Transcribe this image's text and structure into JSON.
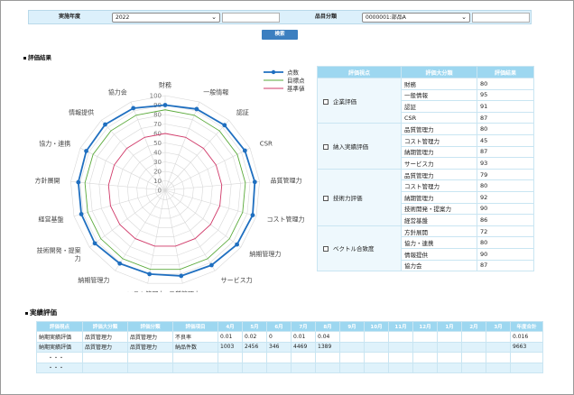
{
  "filters": {
    "year_label": "実施年度",
    "year_value": "2022",
    "category_label": "品目分類",
    "category_value": "0000001:部品A",
    "search_label": "検索"
  },
  "colors": {
    "score": "#1f6fc0",
    "target": "#5aaa3a",
    "standard": "#d23a6a",
    "header": "#9dd7f0"
  },
  "evaluation": {
    "section_title": "評価結果",
    "headers": [
      "評価視点",
      "評価大分類",
      "評価結果"
    ],
    "groups": [
      {
        "name": "企業評価",
        "items": [
          {
            "label": "財務",
            "score": "80"
          },
          {
            "label": "一般情報",
            "score": "95"
          },
          {
            "label": "認証",
            "score": "91"
          },
          {
            "label": "CSR",
            "score": "87"
          }
        ]
      },
      {
        "name": "納入実績評価",
        "items": [
          {
            "label": "品質管理力",
            "score": "80"
          },
          {
            "label": "コスト管理力",
            "score": "45"
          },
          {
            "label": "納期管理力",
            "score": "87"
          },
          {
            "label": "サービス力",
            "score": "93"
          }
        ]
      },
      {
        "name": "技術力評価",
        "items": [
          {
            "label": "品質管理力",
            "score": "79"
          },
          {
            "label": "コスト管理力",
            "score": "80"
          },
          {
            "label": "納期管理力",
            "score": "92"
          },
          {
            "label": "技術開発・提案力",
            "score": "90"
          },
          {
            "label": "経営基盤",
            "score": "86"
          }
        ]
      },
      {
        "name": "ベクトル合致度",
        "items": [
          {
            "label": "方針展開",
            "score": "72"
          },
          {
            "label": "協力・連携",
            "score": "80"
          },
          {
            "label": "情報提供",
            "score": "90"
          },
          {
            "label": "協力会",
            "score": "87"
          }
        ]
      }
    ]
  },
  "chart_data": {
    "type": "radar",
    "axes": [
      "財務",
      "一般情報",
      "認証",
      "CSR",
      "品質管理力",
      "コスト管理力",
      "納期管理力",
      "サービス力",
      "品質管理力",
      "コスト管理力",
      "納期管理力",
      "技術開発・提案力",
      "経営基盤",
      "方針展開",
      "協力・連携",
      "情報提供",
      "協力会"
    ],
    "axis_label_lines": [
      [
        "財務"
      ],
      [
        "一般情報"
      ],
      [
        "認証"
      ],
      [
        "CSR"
      ],
      [
        "品質管理力"
      ],
      [
        "コスト管理力"
      ],
      [
        "納期管理力"
      ],
      [
        "サービス力"
      ],
      [
        "品質管理力"
      ],
      [
        "コスト管理力"
      ],
      [
        "納期管理力"
      ],
      [
        "技術開発・提案",
        "力"
      ],
      [
        "経営基盤"
      ],
      [
        "方針展開"
      ],
      [
        "協力・連携"
      ],
      [
        "情報提供"
      ],
      [
        "協力会"
      ]
    ],
    "rmin": 0,
    "rmax": 100,
    "ticks": [
      "0",
      "10",
      "20",
      "30",
      "40",
      "50",
      "60",
      "70",
      "80",
      "90",
      "100"
    ],
    "grid": true,
    "legend_position": "top-right",
    "series": [
      {
        "name": "点数",
        "color": "#1f6fc0",
        "markers": true,
        "values": [
          90,
          92,
          93,
          94,
          95,
          96,
          95,
          93,
          92,
          90,
          91,
          93,
          92,
          92,
          93,
          94,
          93
        ]
      },
      {
        "name": "目標点",
        "color": "#5aaa3a",
        "markers": false,
        "values": [
          85,
          85,
          85,
          85,
          85,
          85,
          85,
          85,
          85,
          85,
          85,
          85,
          85,
          85,
          85,
          85,
          85
        ]
      },
      {
        "name": "基準値",
        "color": "#d23a6a",
        "markers": false,
        "values": [
          60,
          60,
          60,
          60,
          60,
          60,
          60,
          60,
          60,
          60,
          60,
          60,
          60,
          60,
          60,
          60,
          60
        ]
      }
    ]
  },
  "actual": {
    "section_title": "実績評価",
    "headers": [
      "評価視点",
      "評価大分類",
      "評価分類",
      "評価項目",
      "4月",
      "5月",
      "6月",
      "7月",
      "8月",
      "9月",
      "10月",
      "11月",
      "12月",
      "1月",
      "2月",
      "3月",
      "年度合計"
    ],
    "rows": [
      [
        "納期実績評価",
        "品質管理力",
        "品質管理力",
        "不良率",
        "0.01",
        "0.02",
        "0",
        "0.01",
        "0.04",
        "",
        "",
        "",
        "",
        "",
        "",
        "",
        "0.016"
      ],
      [
        "納期実績評価",
        "品質管理力",
        "品質管理力",
        "納品件数",
        "1003",
        "2456",
        "346",
        "4469",
        "1389",
        "",
        "",
        "",
        "",
        "",
        "",
        "",
        "9663"
      ],
      [
        "・・・",
        "",
        "",
        "",
        "",
        "",
        "",
        "",
        "",
        "",
        "",
        "",
        "",
        "",
        "",
        "",
        ""
      ],
      [
        "・・・",
        "",
        "",
        "",
        "",
        "",
        "",
        "",
        "",
        "",
        "",
        "",
        "",
        "",
        "",
        "",
        ""
      ]
    ]
  }
}
